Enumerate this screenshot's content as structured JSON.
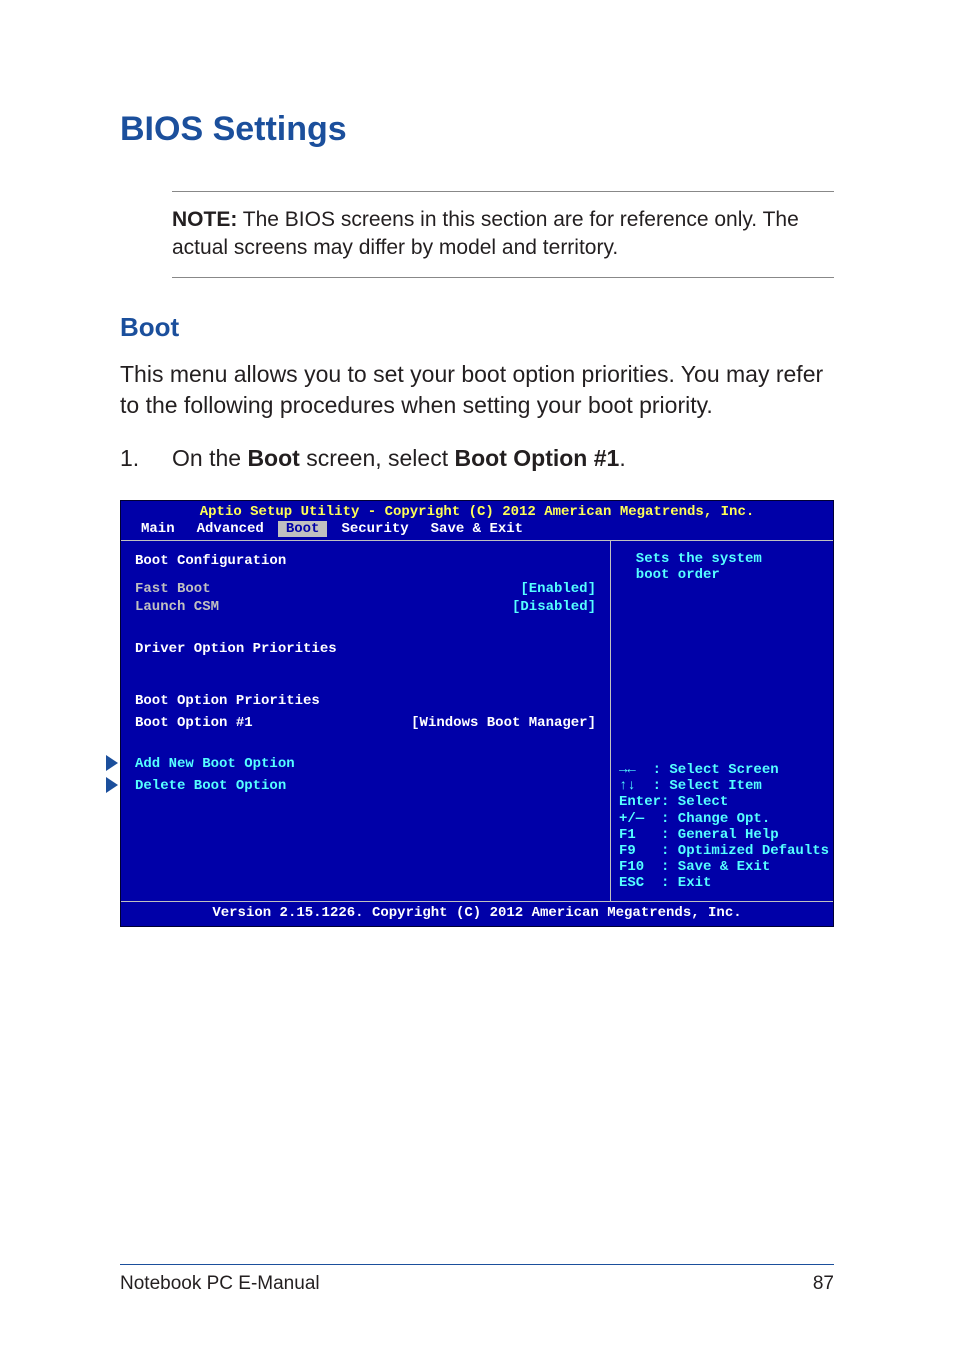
{
  "title": "BIOS Settings",
  "note": {
    "label": "NOTE:",
    "text": " The BIOS screens in this section are for reference only. The actual screens may differ by model and territory."
  },
  "section_title": "Boot",
  "intro": "This menu allows you to set your boot option priorities. You may refer to the following procedures when setting your boot priority.",
  "step": {
    "num": "1.",
    "pre": "On the ",
    "b1": "Boot",
    "mid": " screen, select ",
    "b2": "Boot Option #1",
    "post": "."
  },
  "bios": {
    "header": "Aptio Setup Utility - Copyright (C) 2012 American Megatrends, Inc.",
    "menu": {
      "main": "Main",
      "advanced": "Advanced",
      "boot": "Boot",
      "security": "Security",
      "save_exit": "Save & Exit"
    },
    "left": {
      "boot_config": "Boot Configuration",
      "fast_boot_lbl": "Fast Boot",
      "fast_boot_val": "[Enabled]",
      "launch_csm_lbl": "Launch CSM",
      "launch_csm_val": "[Disabled]",
      "driver_prio": "Driver Option Priorities",
      "boot_prio": "Boot Option Priorities",
      "boot_opt1_lbl": "Boot Option #1",
      "boot_opt1_val": "[Windows Boot Manager]",
      "add_new": "Add New Boot Option",
      "delete": "Delete Boot Option"
    },
    "right": {
      "help": "  Sets the system\n  boot order",
      "keys": "→←  : Select Screen\n↑↓  : Select Item\nEnter: Select\n+/—  : Change Opt.\nF1   : General Help\nF9   : Optimized Defaults\nF10  : Save & Exit\nESC  : Exit"
    },
    "footer": "Version 2.15.1226. Copyright (C) 2012 American Megatrends, Inc."
  },
  "footer": {
    "left": "Notebook PC E-Manual",
    "right": "87"
  }
}
